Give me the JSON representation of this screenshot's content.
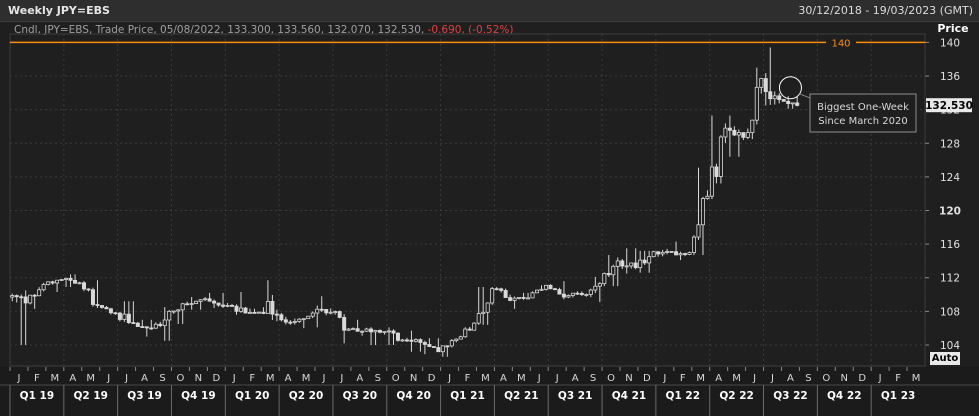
{
  "window": {
    "title": "Weekly JPY=EBS",
    "date_range": "30/12/2018 - 19/03/2023 (GMT)"
  },
  "legend": {
    "prefix": "Cndl, JPY=EBS, Trade Price, 05/08/2022, 133.300, 133.560, 132.070, 132.530,",
    "change": "-0.690, (-0.52%)"
  },
  "controls": {
    "auto_label": "Auto"
  },
  "annotation": {
    "line1": "Biggest One-Week",
    "line2": "Since March 2020"
  },
  "colors": {
    "background": "#1f1f1f",
    "candle": "#d9d9d9",
    "level_line": "#ff8c00",
    "negative": "#e04040"
  },
  "chart_data": {
    "type": "candlestick",
    "series_name": "JPY=EBS",
    "ylabel": "Price",
    "ylim": [
      101.5,
      141
    ],
    "y_ticks": [
      104,
      108,
      112,
      116,
      120,
      124,
      128,
      132,
      136,
      140
    ],
    "y_tick_bold": 120,
    "grid": true,
    "last_price": {
      "value": 132.53,
      "label": "132.530"
    },
    "reference_line": {
      "value": 140,
      "label": "140"
    },
    "months": [
      "J",
      "F",
      "M",
      "A",
      "M",
      "J",
      "J",
      "A",
      "S",
      "O",
      "N",
      "D",
      "J",
      "F",
      "M",
      "A",
      "M",
      "J",
      "J",
      "A",
      "S",
      "O",
      "N",
      "D",
      "J",
      "F",
      "M",
      "A",
      "M",
      "J",
      "J",
      "A",
      "S",
      "O",
      "N",
      "D",
      "J",
      "F",
      "M",
      "A",
      "M",
      "J",
      "J",
      "A",
      "S",
      "O",
      "N",
      "D",
      "J",
      "F",
      "M"
    ],
    "quarters": [
      "Q1 19",
      "Q2 19",
      "Q3 19",
      "Q4 19",
      "Q1 20",
      "Q2 20",
      "Q3 20",
      "Q4 20",
      "Q1 21",
      "Q2 21",
      "Q3 21",
      "Q4 21",
      "Q1 22",
      "Q2 22",
      "Q3 22",
      "Q4 22",
      "Q1 23"
    ],
    "x_range": [
      "2019-01",
      "2023-03"
    ],
    "monthly_ohlc": [
      {
        "month": "2019-01",
        "open": 109.7,
        "high": 110.5,
        "low": 104.0,
        "close": 109.0
      },
      {
        "month": "2019-02",
        "open": 109.0,
        "high": 111.4,
        "low": 108.3,
        "close": 111.2
      },
      {
        "month": "2019-03",
        "open": 111.2,
        "high": 112.2,
        "low": 110.3,
        "close": 111.8
      },
      {
        "month": "2019-04",
        "open": 111.8,
        "high": 112.4,
        "low": 110.9,
        "close": 111.4
      },
      {
        "month": "2019-05",
        "open": 111.4,
        "high": 111.7,
        "low": 108.4,
        "close": 108.7
      },
      {
        "month": "2019-06",
        "open": 108.7,
        "high": 108.9,
        "low": 106.8,
        "close": 107.8
      },
      {
        "month": "2019-07",
        "open": 107.8,
        "high": 109.2,
        "low": 106.5,
        "close": 106.6
      },
      {
        "month": "2019-08",
        "open": 106.6,
        "high": 107.0,
        "low": 105.0,
        "close": 106.0
      },
      {
        "month": "2019-09",
        "open": 106.0,
        "high": 108.5,
        "low": 104.5,
        "close": 108.0
      },
      {
        "month": "2019-10",
        "open": 108.0,
        "high": 109.3,
        "low": 106.5,
        "close": 108.9
      },
      {
        "month": "2019-11",
        "open": 108.9,
        "high": 109.7,
        "low": 108.2,
        "close": 109.5
      },
      {
        "month": "2019-12",
        "open": 109.5,
        "high": 110.2,
        "low": 108.4,
        "close": 108.6
      },
      {
        "month": "2020-01",
        "open": 108.6,
        "high": 110.3,
        "low": 107.6,
        "close": 108.4
      },
      {
        "month": "2020-02",
        "open": 108.4,
        "high": 112.2,
        "low": 107.8,
        "close": 107.9
      },
      {
        "month": "2020-03",
        "open": 107.9,
        "high": 111.7,
        "low": 101.6,
        "close": 107.6
      },
      {
        "month": "2020-04",
        "open": 107.6,
        "high": 109.4,
        "low": 106.4,
        "close": 106.8
      },
      {
        "month": "2020-05",
        "open": 106.8,
        "high": 108.0,
        "low": 106.0,
        "close": 107.8
      },
      {
        "month": "2020-06",
        "open": 107.8,
        "high": 109.8,
        "low": 106.1,
        "close": 107.9
      },
      {
        "month": "2020-07",
        "open": 107.9,
        "high": 108.1,
        "low": 104.2,
        "close": 105.9
      },
      {
        "month": "2020-08",
        "open": 105.9,
        "high": 107.0,
        "low": 105.1,
        "close": 105.9
      },
      {
        "month": "2020-09",
        "open": 105.9,
        "high": 106.5,
        "low": 104.0,
        "close": 105.6
      },
      {
        "month": "2020-10",
        "open": 105.6,
        "high": 106.1,
        "low": 104.0,
        "close": 104.6
      },
      {
        "month": "2020-11",
        "open": 104.6,
        "high": 105.7,
        "low": 103.2,
        "close": 104.3
      },
      {
        "month": "2020-12",
        "open": 104.3,
        "high": 104.8,
        "low": 102.9,
        "close": 103.2
      },
      {
        "month": "2021-01",
        "open": 103.2,
        "high": 104.9,
        "low": 102.6,
        "close": 104.7
      },
      {
        "month": "2021-02",
        "open": 104.7,
        "high": 106.7,
        "low": 104.4,
        "close": 106.6
      },
      {
        "month": "2021-03",
        "open": 106.6,
        "high": 110.9,
        "low": 106.4,
        "close": 110.7
      },
      {
        "month": "2021-04",
        "open": 110.7,
        "high": 110.9,
        "low": 107.5,
        "close": 109.3
      },
      {
        "month": "2021-05",
        "open": 109.3,
        "high": 110.2,
        "low": 108.3,
        "close": 109.6
      },
      {
        "month": "2021-06",
        "open": 109.6,
        "high": 111.1,
        "low": 109.2,
        "close": 111.1
      },
      {
        "month": "2021-07",
        "open": 111.1,
        "high": 111.6,
        "low": 109.1,
        "close": 109.7
      },
      {
        "month": "2021-08",
        "open": 109.7,
        "high": 110.8,
        "low": 108.7,
        "close": 110.0
      },
      {
        "month": "2021-09",
        "open": 110.0,
        "high": 112.1,
        "low": 109.1,
        "close": 111.3
      },
      {
        "month": "2021-10",
        "open": 111.3,
        "high": 114.7,
        "low": 111.0,
        "close": 114.0
      },
      {
        "month": "2021-11",
        "open": 114.0,
        "high": 115.5,
        "low": 112.5,
        "close": 113.2
      },
      {
        "month": "2021-12",
        "open": 113.2,
        "high": 115.2,
        "low": 112.6,
        "close": 115.1
      },
      {
        "month": "2022-01",
        "open": 115.1,
        "high": 116.3,
        "low": 113.5,
        "close": 115.1
      },
      {
        "month": "2022-02",
        "open": 115.1,
        "high": 116.3,
        "low": 114.1,
        "close": 115.0
      },
      {
        "month": "2022-03",
        "open": 115.0,
        "high": 125.1,
        "low": 114.7,
        "close": 121.7
      },
      {
        "month": "2022-04",
        "open": 121.7,
        "high": 131.3,
        "low": 121.3,
        "close": 129.8
      },
      {
        "month": "2022-05",
        "open": 129.8,
        "high": 131.3,
        "low": 126.4,
        "close": 128.7
      },
      {
        "month": "2022-06",
        "open": 128.7,
        "high": 137.0,
        "low": 128.5,
        "close": 135.7
      },
      {
        "month": "2022-07",
        "open": 135.7,
        "high": 139.4,
        "low": 132.5,
        "close": 133.2
      },
      {
        "month": "2022-08",
        "open": 133.2,
        "high": 133.6,
        "low": 132.1,
        "close": 132.5
      }
    ]
  }
}
